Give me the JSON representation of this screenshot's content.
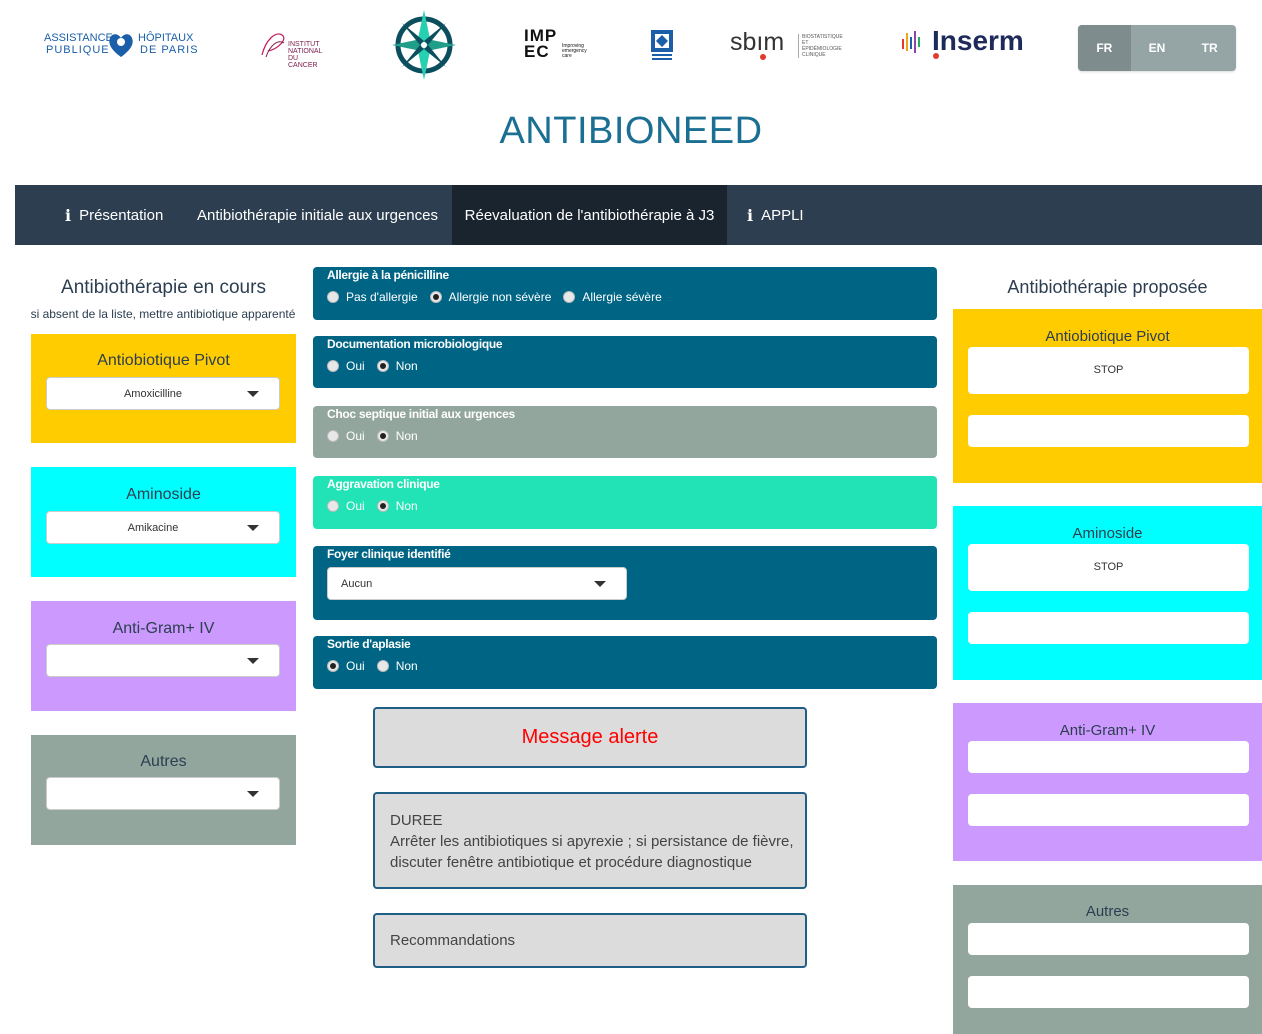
{
  "header": {
    "logos": {
      "aphp": {
        "line1": "ASSISTANCE",
        "line2": "PUBLIQUE",
        "line3": "HÔPITAUX",
        "line4": "DE PARIS"
      },
      "inca": {
        "text": "INSTITUT NATIONAL DU CANCER"
      },
      "impec": {
        "big": "IMP EC",
        "small": "Improving emergency care"
      },
      "sbim": {
        "word": "sbım",
        "sub": "BIOSTATISTIQUE ET ÉPIDÉMIOLOGIE CLINIQUE"
      },
      "inserm": {
        "word": "Inserm"
      }
    },
    "language_buttons": [
      {
        "label": "FR",
        "icon": "fr-flag-icon"
      },
      {
        "label": "EN",
        "icon": "en-flag-icon"
      },
      {
        "label": "TR",
        "icon": "tr-flag-icon"
      }
    ]
  },
  "app_title": "ANTIBIONEED",
  "navbar": {
    "items": [
      {
        "label": "Présentation",
        "icon": "info-icon"
      },
      {
        "label": "Antibiothérapie initiale aux urgences"
      },
      {
        "label": "Réevaluation de l'antibiothérapie à J3",
        "active": true
      },
      {
        "label": "APPLI",
        "icon": "info-icon"
      }
    ]
  },
  "left": {
    "title": "Antibiothérapie en cours",
    "subtitle": "si absent de la liste, mettre antibiotique apparenté",
    "panels": [
      {
        "title": "Antiobiotique Pivot",
        "value": "Amoxicilline",
        "color": "#ffcc00"
      },
      {
        "title": "Aminoside",
        "value": "Amikacine",
        "color": "#00ffff"
      },
      {
        "title": "Anti-Gram+ IV",
        "value": "",
        "color": "#cc99ff"
      },
      {
        "title": "Autres",
        "value": "",
        "color": "#93a69e"
      }
    ]
  },
  "center": {
    "questions": [
      {
        "label": "Allergie à la pénicilline",
        "options": [
          "Pas d'allergie",
          "Allergie non sévère",
          "Allergie sévère"
        ],
        "selected": 1,
        "color": "#006585"
      },
      {
        "label": "Documentation microbiologique",
        "options": [
          "Oui",
          "Non"
        ],
        "selected": 1,
        "color": "#006585"
      },
      {
        "label": "Choc septique initial aux urgences",
        "options": [
          "Oui",
          "Non"
        ],
        "selected": 1,
        "color": "#93a69e"
      },
      {
        "label": "Aggravation clinique",
        "options": [
          "Oui",
          "Non"
        ],
        "selected": 1,
        "color": "#22e3b5"
      },
      {
        "label": "Foyer clinique identifié",
        "select_value": "Aucun",
        "color": "#006585"
      },
      {
        "label": "Sortie d'aplasie",
        "options": [
          "Oui",
          "Non"
        ],
        "selected": 0,
        "color": "#006585"
      }
    ],
    "alert_message": "Message alerte",
    "alert_color": "#ff0000",
    "duree": {
      "title": "DUREE",
      "line1": "Arrêter les antibiotiques si apyrexie ; si persistance de fièvre,",
      "line2": "discuter fenêtre antibiotique et procédure diagnostique"
    },
    "recommandations": "Recommandations"
  },
  "right": {
    "title": "Antibiothérapie proposée",
    "panels": [
      {
        "title": "Antiobiotique Pivot",
        "value1": "STOP",
        "value2": "",
        "color": "#ffcc00"
      },
      {
        "title": "Aminoside",
        "value1": "STOP",
        "value2": "",
        "color": "#00ffff"
      },
      {
        "title": "Anti-Gram+ IV",
        "value1": "",
        "value2": "",
        "color": "#cc99ff"
      },
      {
        "title": "Autres",
        "value1": "",
        "value2": "",
        "color": "#93a69e"
      }
    ]
  }
}
